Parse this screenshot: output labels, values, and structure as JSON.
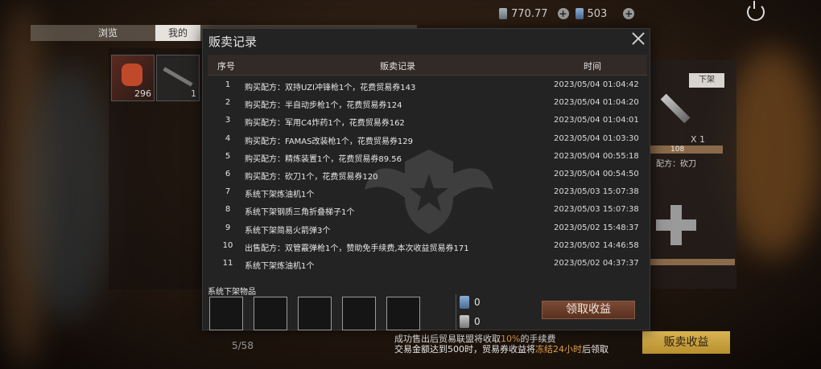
{
  "topbar": {
    "currency_a": "770.77",
    "currency_b": "503"
  },
  "tabs": [
    {
      "label": "浏览"
    },
    {
      "label": "我的"
    }
  ],
  "inventory": [
    {
      "count": "296"
    },
    {
      "count": "1"
    }
  ],
  "page_counter": "5/58",
  "right_panel": {
    "unlist_label": "下架",
    "qty": "X 1",
    "price": "108",
    "recipe": "配方：砍刀"
  },
  "sell_income_label": "贩卖收益",
  "notice": {
    "line1_prefix": "成功售出后贸易联盟将收取",
    "line1_pct": "10%",
    "line1_suffix": "的手续费",
    "line2_prefix": "交易金额达到500时，贸易券收益将",
    "line2_hl": "冻结24小时",
    "line2_suffix": "后领取"
  },
  "modal": {
    "title": "贩卖记录",
    "columns": {
      "seq": "序号",
      "record": "贩卖记录",
      "time": "时间"
    },
    "rows": [
      {
        "seq": "1",
        "record": "购买配方：双持UZI冲锋枪1个，花费贸易券143",
        "time": "2023/05/04 01:04:42"
      },
      {
        "seq": "2",
        "record": "购买配方：半自动步枪1个，花费贸易券124",
        "time": "2023/05/04 01:04:20"
      },
      {
        "seq": "3",
        "record": "购买配方：军用C4炸药1个，花费贸易券162",
        "time": "2023/05/04 01:04:01"
      },
      {
        "seq": "4",
        "record": "购买配方：FAMAS改装枪1个，花费贸易券129",
        "time": "2023/05/04 01:03:30"
      },
      {
        "seq": "5",
        "record": "购买配方：精炼装置1个，花费贸易券89.56",
        "time": "2023/05/04 00:55:18"
      },
      {
        "seq": "6",
        "record": "购买配方：砍刀1个，花费贸易券120",
        "time": "2023/05/04 00:54:50"
      },
      {
        "seq": "7",
        "record": "系统下架炼油机1个",
        "time": "2023/05/03 15:07:38"
      },
      {
        "seq": "8",
        "record": "系统下架钢质三角折叠梯子1个",
        "time": "2023/05/03 15:07:38"
      },
      {
        "seq": "9",
        "record": "系统下架简易火箭弹3个",
        "time": "2023/05/02 15:48:37"
      },
      {
        "seq": "10",
        "record": "出售配方：双管霰弹枪1个，赞助免手续费,本次收益贸易券171",
        "time": "2023/05/02 14:46:58"
      },
      {
        "seq": "11",
        "record": "系统下架炼油机1个",
        "time": "2023/05/02 04:37:37"
      }
    ],
    "system_unlisted_label": "系统下架物品",
    "ticket_a_value": "0",
    "ticket_b_value": "0",
    "claim_label": "领取收益"
  }
}
